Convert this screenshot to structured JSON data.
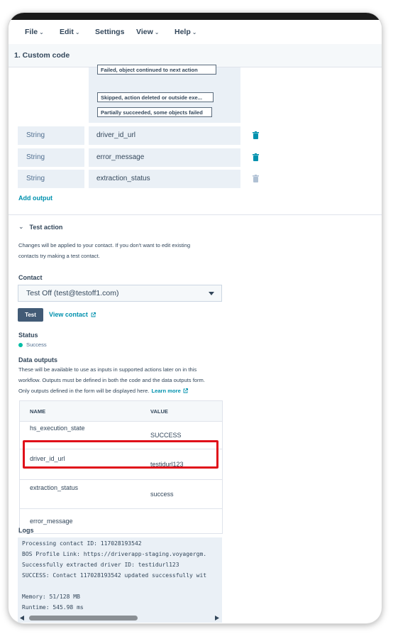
{
  "menu": [
    {
      "label": "File",
      "has_chevron": true
    },
    {
      "label": "Edit",
      "has_chevron": true
    },
    {
      "label": "Settings",
      "has_chevron": false
    },
    {
      "label": "View",
      "has_chevron": true
    },
    {
      "label": "Help",
      "has_chevron": true
    }
  ],
  "section_title": "1. Custom code",
  "branch_states": [
    "Failed, object continued to next action",
    "Skipped, action deleted or outside exe...",
    "Partially succeeded, some objects failed"
  ],
  "outputs": [
    {
      "type": "String",
      "name": "driver_id_url"
    },
    {
      "type": "String",
      "name": "error_message"
    },
    {
      "type": "String",
      "name": "extraction_status"
    }
  ],
  "add_output_label": "Add output",
  "test_action": {
    "title": "Test action",
    "description_1": "Changes will be applied to your contact. If you don't want to edit existing",
    "description_2": "contacts try making a test contact.",
    "contact_label": "Contact",
    "contact_value": "Test Off (test@testoff1.com)",
    "test_button": "Test",
    "view_contact_link": "View contact"
  },
  "status": {
    "label": "Status",
    "value": "Success",
    "color": "#00bda5"
  },
  "data_outputs": {
    "label": "Data outputs",
    "desc_1": "These will be available to use as inputs in supported actions later on in this",
    "desc_2": "workflow. Outputs must be defined in both the code and the data outputs form.",
    "desc_3": "Only outputs defined in the form will be displayed here.",
    "learn_more": "Learn more",
    "col_name": "NAME",
    "col_value": "VALUE",
    "rows": [
      {
        "name": "hs_execution_state",
        "value": "SUCCESS"
      },
      {
        "name": "driver_id_url",
        "value": "testidurl123"
      },
      {
        "name": "extraction_status",
        "value": "success"
      },
      {
        "name": "error_message",
        "value": ""
      }
    ],
    "highlight_color": "#e0101a"
  },
  "logs": {
    "label": "Logs",
    "lines": [
      "Processing contact ID: 117028193542",
      "BOS Profile Link: https://driverapp-staging.voyagergm.",
      "Successfully extracted driver ID: testidurl123",
      "SUCCESS: Contact 117028193542 updated successfully wit",
      "",
      "Memory: 51/128 MB",
      "Runtime: 545.98 ms"
    ]
  },
  "colors": {
    "link": "#0091ae",
    "button_dark": "#425b76",
    "input_bg": "#eaf0f6"
  }
}
